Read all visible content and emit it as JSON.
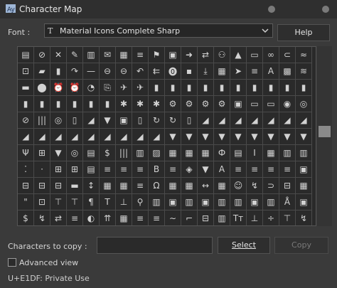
{
  "window": {
    "title": "Character Map",
    "app_icon": "character-map-icon"
  },
  "font_row": {
    "label": "Font :",
    "selected_font": "Material Icons Complete Sharp",
    "font_glyph": "T",
    "help_button": "Help"
  },
  "grid": {
    "rows": [
      [
        "▤",
        "⊘",
        "✕",
        "✎",
        "▥",
        "✉",
        "▦",
        "≡",
        "⚑",
        "▣",
        "➜",
        "⇄",
        "⚇",
        "▲",
        "▭",
        "∞",
        "⊂",
        "≈"
      ],
      [
        "⊡",
        "▰",
        "▮",
        "↷",
        "—",
        "⊖",
        "⊖",
        "↶",
        "⇇",
        "⓿",
        "▪",
        "⤓",
        "▦",
        "➤",
        "≡",
        "A",
        "▩",
        "≋"
      ],
      [
        "▬",
        "⬤",
        "⏰",
        "⏰",
        "◔",
        "⎘",
        "✈",
        "✈",
        "▮",
        "▮",
        "▮",
        "▮",
        "▮",
        "▮",
        "▮",
        "▮",
        "▮",
        "▮"
      ],
      [
        "▮",
        "▮",
        "▮",
        "▮",
        "▮",
        "▮",
        "✱",
        "✱",
        "✱",
        "⚙",
        "⚙",
        "⚙",
        "⚙",
        "▣",
        "▭",
        "▭",
        "◉",
        "◎"
      ],
      [
        "⊘",
        "|||",
        "◎",
        "▯",
        "◢",
        "▼",
        "▣",
        "▯",
        "↻",
        "↻",
        "▯",
        "◢",
        "◢",
        "◢",
        "◢",
        "◢",
        "◢",
        "◢"
      ],
      [
        "◢",
        "◢",
        "◢",
        "◢",
        "◢",
        "◢",
        "◢",
        "◢",
        "◢",
        "▼",
        "▼",
        "▼",
        "▼",
        "▼",
        "▼",
        "▼",
        "▼",
        "▼"
      ],
      [
        "Ψ",
        "⊞",
        "▼",
        "◎",
        "▤",
        "$",
        "|||",
        "▥",
        "▨",
        "▦",
        "▦",
        "▦",
        "Ф",
        "▤",
        "I",
        "▦",
        "▥",
        "▥"
      ],
      [
        "⁚",
        "⋅",
        "⊞",
        "⊞",
        "▤",
        "≡",
        "≡",
        "≡",
        "B",
        "≡",
        "◈",
        "▼",
        "A",
        "≡",
        "≡",
        "≡",
        "≡",
        "▣"
      ],
      [
        "⊟",
        "⊟",
        "⊟",
        "▬",
        "↕",
        "▦",
        "▦",
        "≡",
        "Ω",
        "▦",
        "▦",
        "↔",
        "▦",
        "☺",
        "↯",
        "⊃",
        "⊟",
        "▦"
      ],
      [
        "\"",
        "⊡",
        "⊤",
        "⊤",
        "¶",
        "T",
        "⊥",
        "⚲",
        "▥",
        "▣",
        "▥",
        "▣",
        "▥",
        "▥",
        "▣",
        "▥",
        "Å",
        "▣"
      ],
      [
        "$",
        "↯",
        "⇄",
        "≡",
        "◐",
        "⇈",
        "▦",
        "≡",
        "≡",
        "∼",
        "⌐",
        "⊟",
        "▥",
        "Tт",
        "⊥",
        "÷",
        "⊤",
        "↯"
      ]
    ]
  },
  "copy_row": {
    "label": "Characters to copy :",
    "input_value": "",
    "select_button": "Select",
    "copy_button": "Copy"
  },
  "advanced": {
    "label": "Advanced view",
    "checked": false
  },
  "status": {
    "text": "U+E1DF: Private Use"
  }
}
